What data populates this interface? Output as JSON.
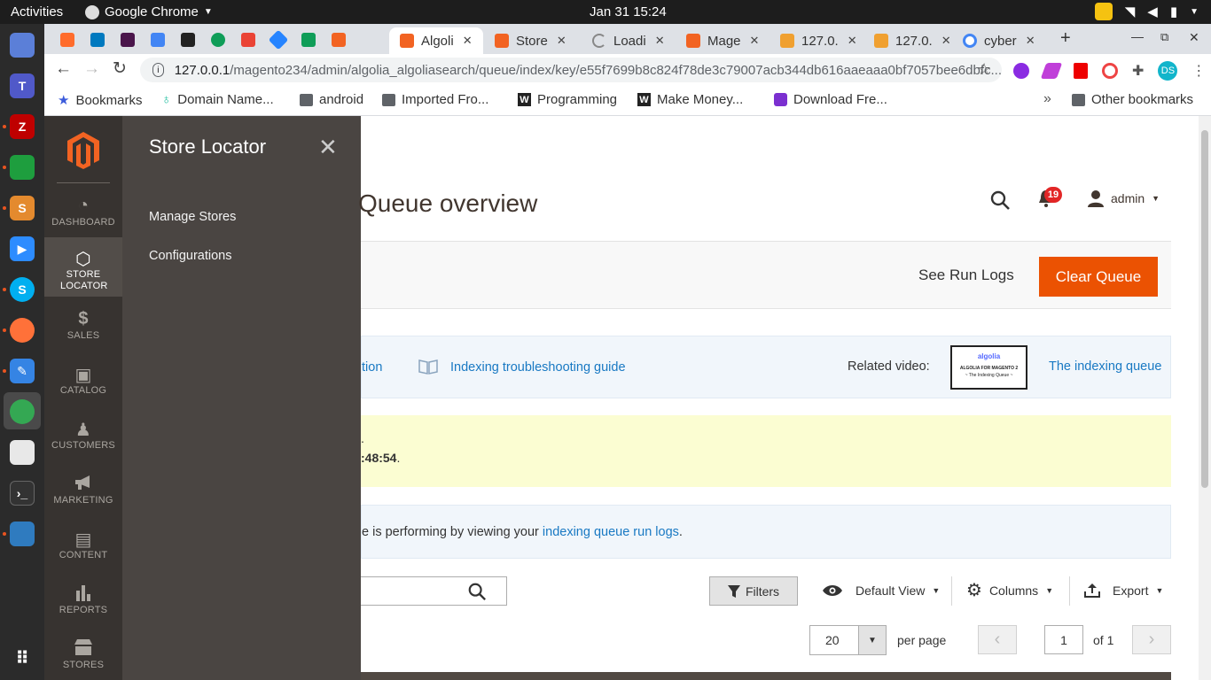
{
  "os": {
    "activities": "Activities",
    "app_name": "Google Chrome",
    "clock": "Jan 31  15:24"
  },
  "tabs": [
    {
      "label": "Algoli",
      "active": true
    },
    {
      "label": "Store",
      "active": false
    },
    {
      "label": "Loadi",
      "active": false
    },
    {
      "label": "Mage",
      "active": false
    },
    {
      "label": "127.0.",
      "active": false
    },
    {
      "label": "127.0.",
      "active": false
    },
    {
      "label": "cyber",
      "active": false
    }
  ],
  "address": {
    "host": "127.0.0.1",
    "path": "/magento234/admin/algolia_algoliasearch/queue/index/key/e55f7699b8c824f78de3c79007acb344db616aaeaaa0bf7057bee6dbfc..."
  },
  "bookmarks": [
    "Bookmarks",
    "Domain Name...",
    "android",
    "Imported Fro...",
    "Programming",
    "Make Money...",
    "Download Fre...",
    "Other bookmarks"
  ],
  "profile_initials": "DS",
  "admin_nav": [
    {
      "label": "DASHBOARD",
      "glyph": "◔"
    },
    {
      "label": "STORE LOCATOR",
      "glyph": "⬡"
    },
    {
      "label": "SALES",
      "glyph": "$"
    },
    {
      "label": "CATALOG",
      "glyph": "▣"
    },
    {
      "label": "CUSTOMERS",
      "glyph": "♟"
    },
    {
      "label": "MARKETING",
      "glyph": "📢"
    },
    {
      "label": "CONTENT",
      "glyph": "▤"
    },
    {
      "label": "REPORTS",
      "glyph": "▮"
    },
    {
      "label": "STORES",
      "glyph": "⌂"
    }
  ],
  "flyout": {
    "title": "Store Locator",
    "links": [
      "Manage Stores",
      "Configurations"
    ]
  },
  "header": {
    "title": "Queue overview",
    "notification_count": "19",
    "user": "admin"
  },
  "actions": {
    "see_run_logs": "See Run Logs",
    "clear_queue": "Clear Queue"
  },
  "info": {
    "link1": "tion",
    "link2": "Indexing troubleshooting guide",
    "related_label": "Related video:",
    "thumb_brand": "algolia",
    "thumb_line1": "ALGOLIA FOR MAGENTO 2",
    "thumb_line2": "~ The Indexing Queue ~",
    "video_link": "The indexing queue"
  },
  "warning": {
    "line1": ".",
    "line2": ":48:54",
    "line2_end": "."
  },
  "notice": {
    "text": "e is performing by viewing your ",
    "link": "indexing queue run logs",
    "end": "."
  },
  "grid": {
    "filters": "Filters",
    "default_view": "Default View",
    "columns": "Columns",
    "export": "Export",
    "per_page_value": "20",
    "per_page_label": "per page",
    "page_value": "1",
    "page_of": "of 1"
  },
  "colors": {
    "magento_orange": "#eb5202",
    "nav_bg": "#373330",
    "flyout_bg": "#4a4542",
    "link_blue": "#1979c3"
  }
}
